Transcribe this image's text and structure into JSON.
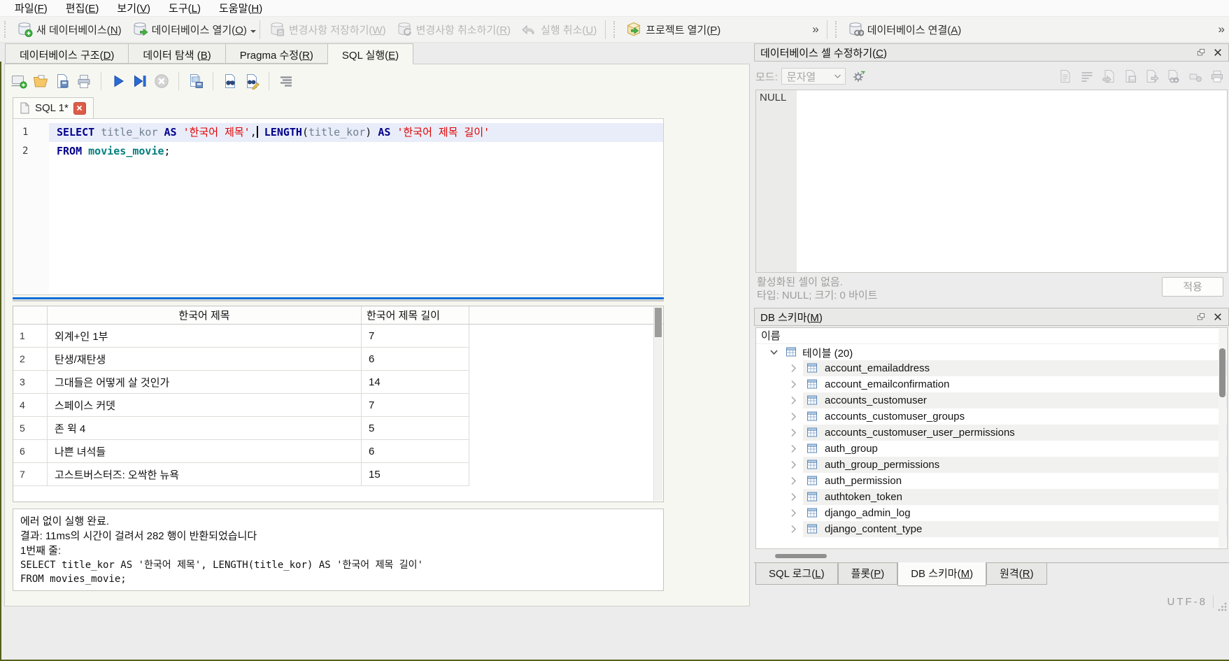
{
  "colors": {
    "accent_splitter": "#0c6cd6",
    "sql_keyword": "#00008b",
    "sql_string": "#e00000",
    "sql_table": "#007f7f",
    "close_tab_red": "#dd5d49"
  },
  "icons": {
    "new-database-icon": "db cylinder + green plus",
    "open-database-icon": "db cylinder + green arrow",
    "write-changes-icon": "db cylinder + floppy (disabled)",
    "revert-changes-icon": "db cylinder + circular arrows (disabled)",
    "undo-icon": "left curved arrow (disabled)",
    "open-project-icon": "yellow box + green arrow",
    "attach-database-icon": "db cylinder + chain links",
    "new-sql-tab-icon": "screen + green plus",
    "open-sql-file-icon": "yellow folder",
    "save-sql-file-icon": "document + floppy",
    "print-icon": "printer",
    "execute-all-icon": "blue play triangle",
    "execute-current-icon": "blue play triangle + bar",
    "stop-icon": "gray circle + white x",
    "save-results-icon": "document + grid + floppy",
    "find-icon": "document + binoculars",
    "find-replace-icon": "document + binoculars + pencil",
    "word-wrap-icon": "horizontal text lines",
    "gear-icon": "gear + green arrow",
    "table-icon": "blue grid table",
    "chevron-right-icon": ">",
    "chevron-down-icon": "v",
    "float-dock-icon": "two overlapping squares",
    "close-icon": "x"
  },
  "menu": {
    "file": "파일(F)",
    "edit": "편집(E)",
    "view": "보기(V)",
    "tools": "도구(L)",
    "help": "도움말(H)"
  },
  "toolbar": {
    "new_db": "새 데이터베이스(N)",
    "open_db": "데이터베이스 열기(O)",
    "write_changes": "변경사항 저장하기(W)",
    "revert_changes": "변경사항 취소하기(R)",
    "undo": "실행 취소(U)",
    "open_project": "프로젝트 열기(P)",
    "attach_db": "데이터베이스 연결(A)",
    "overflow": "»"
  },
  "main_tabs": {
    "structure": "데이터베이스 구조(D)",
    "browse": "데이터 탐색 (B)",
    "pragma": "Pragma 수정(R)",
    "execute": "SQL 실행(E)"
  },
  "sql_editor": {
    "tab": "SQL 1*",
    "line_numbers": [
      "1",
      "2"
    ],
    "line1": {
      "kw1": "SELECT ",
      "id1": "title_kor ",
      "kw2": "AS ",
      "str1": "'한국어 제목'",
      "p1": ",",
      "sp1": " ",
      "kw3": "LENGTH",
      "p2": "(",
      "id2": "title_kor",
      "p3": ") ",
      "kw4": "AS ",
      "str2": "'한국어 제목 길이'"
    },
    "line2": {
      "kw1": "FROM ",
      "id1": "movies_movie",
      "p1": ";"
    }
  },
  "results": {
    "headers": [
      "한국어 제목",
      "한국어 제목 길이"
    ],
    "rows": [
      {
        "num": "1",
        "title": "외계+인 1부",
        "len": "7"
      },
      {
        "num": "2",
        "title": "탄생/재탄생",
        "len": "6"
      },
      {
        "num": "3",
        "title": "그대들은 어떻게 살 것인가",
        "len": "14"
      },
      {
        "num": "4",
        "title": "스페이스 커뎃",
        "len": "7"
      },
      {
        "num": "5",
        "title": "존 윅 4",
        "len": "5"
      },
      {
        "num": "6",
        "title": "나쁜 녀석들",
        "len": "6"
      },
      {
        "num": "7",
        "title": "고스트버스터즈: 오싹한 뉴욕",
        "len": "15"
      }
    ]
  },
  "log": {
    "line1": "에러 없이 실행 완료.",
    "line2": "결과: 11ms의 시간이 걸려서 282 행이 반환되었습니다",
    "line3": "1번째 줄:",
    "line4": "SELECT title_kor AS '한국어 제목', LENGTH(title_kor) AS '한국어 제목 길이'",
    "line5": "FROM movies_movie;"
  },
  "cell_editor": {
    "title": "데이터베이스 셀 수정하기(C)",
    "mode_label": "모드:",
    "mode_value": "문자열",
    "content": "NULL",
    "status1": "활성화된 셀이 없음.",
    "status2": "타입: NULL; 크기: 0 바이트",
    "apply": "적용"
  },
  "schema": {
    "title": "DB 스키마(M)",
    "column_header": "이름",
    "root": "테이블 (20)",
    "tables": [
      "account_emailaddress",
      "account_emailconfirmation",
      "accounts_customuser",
      "accounts_customuser_groups",
      "accounts_customuser_user_permissions",
      "auth_group",
      "auth_group_permissions",
      "auth_permission",
      "authtoken_token",
      "django_admin_log",
      "django_content_type"
    ]
  },
  "bottom_tabs": {
    "sql_log": "SQL 로그(L)",
    "plot": "플롯(P)",
    "db_schema": "DB 스키마(M)",
    "remote": "원격(R)"
  },
  "statusbar": {
    "encoding": "UTF-8"
  }
}
